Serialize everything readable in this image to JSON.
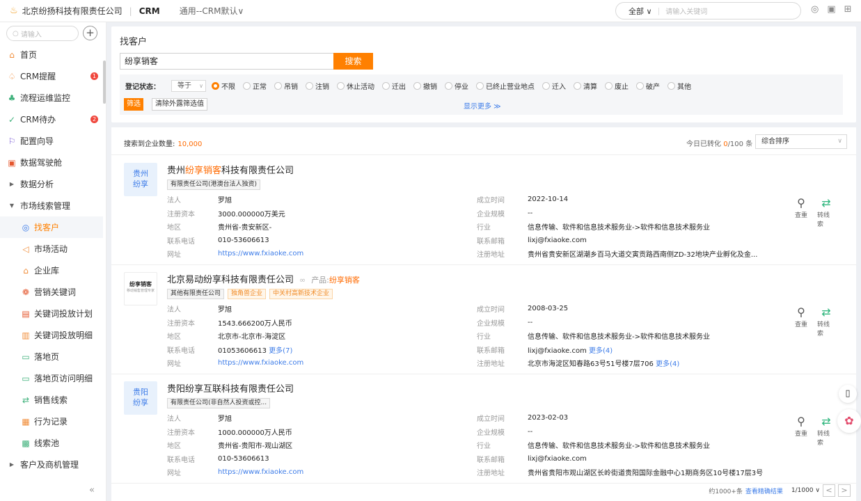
{
  "topbar": {
    "company": "北京纷扬科技有限责任公司",
    "separator": "|",
    "product": "CRM",
    "workspace": "通用--CRM默认",
    "workspace_caret": "∨",
    "search_scope": "全部 ∨",
    "search_placeholder": "请输入关键词",
    "icons": [
      "check-circle-icon",
      "calendar-icon",
      "grid-icon"
    ]
  },
  "sidebar": {
    "search_placeholder": "请输入",
    "add_label": "+",
    "collapse_label": "«",
    "items": [
      {
        "label": "首页",
        "icon": "home-icon",
        "glyph": "⌂"
      },
      {
        "label": "CRM提醒",
        "icon": "bell-icon",
        "glyph": "♤",
        "badge": "1"
      },
      {
        "label": "流程运维监控",
        "icon": "flow-icon",
        "glyph": "♣"
      },
      {
        "label": "CRM待办",
        "icon": "todo-icon",
        "glyph": "✓",
        "badge": "2"
      },
      {
        "label": "配置向导",
        "icon": "flag-icon",
        "glyph": "⚐"
      },
      {
        "label": "数据驾驶舱",
        "icon": "dashboard-icon",
        "glyph": "▣"
      },
      {
        "label": "数据分析",
        "icon": "caret-right-icon",
        "glyph": "▶"
      },
      {
        "label": "市场线索管理",
        "icon": "caret-down-icon",
        "glyph": "▼"
      },
      {
        "label": "找客户",
        "icon": "find-customer-icon",
        "glyph": "◎"
      },
      {
        "label": "市场活动",
        "icon": "megaphone-icon",
        "glyph": "◁"
      },
      {
        "label": "企业库",
        "icon": "building-icon",
        "glyph": "⌂"
      },
      {
        "label": "营销关键词",
        "icon": "keyword-icon",
        "glyph": "❁"
      },
      {
        "label": "关键词投放计划",
        "icon": "plan-icon",
        "glyph": "▤"
      },
      {
        "label": "关键词投放明细",
        "icon": "detail-icon",
        "glyph": "▥"
      },
      {
        "label": "落地页",
        "icon": "landing-icon",
        "glyph": "▭"
      },
      {
        "label": "落地页访问明细",
        "icon": "landing-visit-icon",
        "glyph": "▭"
      },
      {
        "label": "销售线索",
        "icon": "leads-icon",
        "glyph": "⇄"
      },
      {
        "label": "行为记录",
        "icon": "record-icon",
        "glyph": "▦"
      },
      {
        "label": "线索池",
        "icon": "pool-icon",
        "glyph": "▩"
      },
      {
        "label": "客户及商机管理",
        "icon": "caret-right-icon",
        "glyph": "▶"
      }
    ]
  },
  "filter": {
    "title": "找客户",
    "search_value": "纷享销客",
    "search_button": "搜索",
    "status_label": "登记状态：",
    "operator": "等于",
    "operator_caret": "∨",
    "options": [
      "不限",
      "正常",
      "吊销",
      "注销",
      "休止活动",
      "迁出",
      "撤销",
      "停业",
      "已终止营业地点",
      "迁入",
      "清算",
      "废止",
      "破产",
      "其他"
    ],
    "selected": "不限",
    "filter_button": "筛选",
    "clear_button": "清除外露筛选值",
    "show_more": "显示更多 ≫"
  },
  "results": {
    "count_label": "搜索到企业数量:",
    "count_value": "10,000",
    "today_prefix": "今日已转化",
    "today_used": "0",
    "today_suffix": "/100 条",
    "sort_value": "综合排序",
    "sort_caret": "∨",
    "action_check": "查重",
    "action_convert": "转线索",
    "field_labels": {
      "legal": "法人",
      "capital": "注册资本",
      "region": "地区",
      "phone": "联系电话",
      "website": "网址",
      "founded": "成立时间",
      "scale": "企业规模",
      "industry": "行业",
      "email": "联系邮箱",
      "address": "注册地址"
    },
    "companies": [
      {
        "avatar_line1": "贵州",
        "avatar_line2": "纷享",
        "name_pre": "贵州",
        "name_hl": "纷享销客",
        "name_post": "科技有限责任公司",
        "tags": [
          "有限责任公司(港澳台法人独资)"
        ],
        "legal": "罗旭",
        "capital": "3000.000000万美元",
        "region": "贵州省-贵安新区-",
        "phone": "010-53606613",
        "website": "https://www.fxiaoke.com",
        "founded": "2022-10-14",
        "scale": "--",
        "industry": "信息传输、软件和信息技术服务业->软件和信息技术服务业",
        "email": "lixj@fxiaoke.com",
        "address": "贵州省贵安新区湖潮乡百马大道交寅贡路西南侧ZD-32地块产业孵化及金..."
      },
      {
        "avatar_logo": "纷享销客",
        "avatar_logo_sub": "移动销售管理专家",
        "name": "北京易动纷享科技有限责任公司",
        "product_label": "产品:",
        "product_value": "纷享销客",
        "tags": [
          "其他有限责任公司",
          "独角兽企业",
          "中关村高新技术企业"
        ],
        "legal": "罗旭",
        "capital": "1543.666200万人民币",
        "region": "北京市-北京市-海淀区",
        "phone": "01053606613",
        "phone_more": "更多(7)",
        "website": "https://www.fxiaoke.com",
        "founded": "2008-03-25",
        "scale": "--",
        "industry": "信息传输、软件和信息技术服务业->软件和信息技术服务业",
        "email": "lixj@fxiaoke.com",
        "email_more": "更多(4)",
        "address": "北京市海淀区知春路63号51号楼7层706",
        "address_more": "更多(4)"
      },
      {
        "avatar_line1": "贵阳",
        "avatar_line2": "纷享",
        "name": "贵阳纷享互联科技有限责任公司",
        "tags": [
          "有限责任公司(非自然人投资或控..."
        ],
        "legal": "罗旭",
        "capital": "1000.000000万人民币",
        "region": "贵州省-贵阳市-观山湖区",
        "phone": "010-53606613",
        "website": "https://www.fxiaoke.com",
        "founded": "2023-02-03",
        "scale": "--",
        "industry": "信息传输、软件和信息技术服务业->软件和信息技术服务业",
        "email": "lixj@fxiaoke.com",
        "address": "贵州省贵阳市观山湖区长岭街道贵阳国际金融中心1期商务区10号楼17层3号"
      }
    ]
  },
  "pager": {
    "approx": "约1000+条",
    "precise_link": "查看精确结果",
    "page": "1/1000 ∨",
    "prev": "<",
    "next": ">"
  },
  "floating": {
    "book_glyph": "▯",
    "brain_glyph": "✿"
  },
  "colors": {
    "accent": "#ff8000",
    "link": "#3d7ce8",
    "badge": "#f0483e",
    "green": "#2eb67d"
  }
}
